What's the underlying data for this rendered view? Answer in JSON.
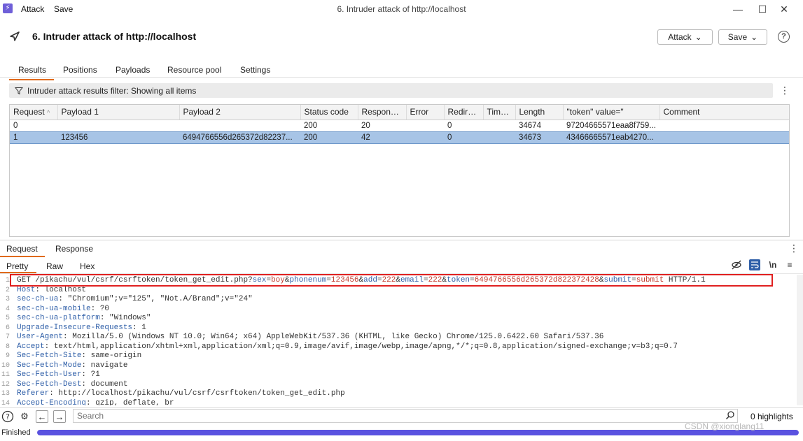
{
  "titlebar": {
    "app_icon": "burp-icon",
    "menu": [
      "Attack",
      "Save"
    ],
    "title": "6. Intruder attack of http://localhost",
    "controls": [
      "minimize-icon",
      "maximize-icon",
      "close-icon"
    ]
  },
  "header": {
    "title": "6. Intruder attack of http://localhost",
    "attack_button": "Attack",
    "save_button": "Save",
    "help_label": "?"
  },
  "tabs": [
    {
      "label": "Results",
      "active": true
    },
    {
      "label": "Positions",
      "active": false
    },
    {
      "label": "Payloads",
      "active": false
    },
    {
      "label": "Resource pool",
      "active": false
    },
    {
      "label": "Settings",
      "active": false
    }
  ],
  "filter": {
    "text": "Intruder attack results filter: Showing all items"
  },
  "results": {
    "columns": [
      "Request",
      "Payload 1",
      "Payload 2",
      "Status code",
      "Response ...",
      "Error",
      "Redirec...",
      "Timeout",
      "Length",
      "\"token\" value=\"",
      "Comment"
    ],
    "rows": [
      [
        "0",
        "",
        "",
        "200",
        "20",
        "",
        "0",
        "",
        "34674",
        "97204665571eaa8f759...",
        ""
      ],
      [
        "1",
        "123456",
        "6494766556d265372d82237...",
        "200",
        "42",
        "",
        "0",
        "",
        "34673",
        "43466665571eab4270...",
        ""
      ]
    ],
    "selected_row": 1
  },
  "lower": {
    "tabs": [
      "Request",
      "Response"
    ],
    "view_tabs": [
      "Pretty",
      "Raw",
      "Hex"
    ],
    "newline_label": "\\n"
  },
  "editor": {
    "request_line": {
      "prefix": "GET /pikachu/vul/csrf/csrftoken/token_get_edit.php?",
      "params": [
        {
          "k": "sex",
          "v": "boy"
        },
        {
          "k": "phonenum",
          "v": "123456"
        },
        {
          "k": "add",
          "v": "222"
        },
        {
          "k": "email",
          "v": "222"
        },
        {
          "k": "token",
          "v": "6494766556d265372d822372428"
        },
        {
          "k": "submit",
          "v": "submit"
        }
      ],
      "suffix": " HTTP/1.1"
    },
    "headers": [
      {
        "k": "Host",
        "v": "localhost"
      },
      {
        "k": "sec-ch-ua",
        "v": "\"Chromium\";v=\"125\", \"Not.A/Brand\";v=\"24\""
      },
      {
        "k": "sec-ch-ua-mobile",
        "v": "?0"
      },
      {
        "k": "sec-ch-ua-platform",
        "v": "\"Windows\""
      },
      {
        "k": "Upgrade-Insecure-Requests",
        "v": "1"
      },
      {
        "k": "User-Agent",
        "v": "Mozilla/5.0 (Windows NT 10.0; Win64; x64) AppleWebKit/537.36 (KHTML, like Gecko) Chrome/125.0.6422.60 Safari/537.36"
      },
      {
        "k": "Accept",
        "v": "text/html,application/xhtml+xml,application/xml;q=0.9,image/avif,image/webp,image/apng,*/*;q=0.8,application/signed-exchange;v=b3;q=0.7"
      },
      {
        "k": "Sec-Fetch-Site",
        "v": "same-origin"
      },
      {
        "k": "Sec-Fetch-Mode",
        "v": "navigate"
      },
      {
        "k": "Sec-Fetch-User",
        "v": "?1"
      },
      {
        "k": "Sec-Fetch-Dest",
        "v": "document"
      },
      {
        "k": "Referer",
        "v": "http://localhost/pikachu/vul/csrf/csrftoken/token_get_edit.php"
      },
      {
        "k": "Accept-Encoding",
        "v": "gzip, deflate, br"
      }
    ]
  },
  "bottom": {
    "search_placeholder": "Search",
    "highlights": "0 highlights",
    "status": "Finished",
    "progress": 1.0,
    "watermark": "CSDN @xionglang11"
  },
  "colors": {
    "accent": "#e06a1c",
    "selected_row": "#a7c4e6",
    "progress": "#5a52e0",
    "highlight_box": "#e02020"
  }
}
